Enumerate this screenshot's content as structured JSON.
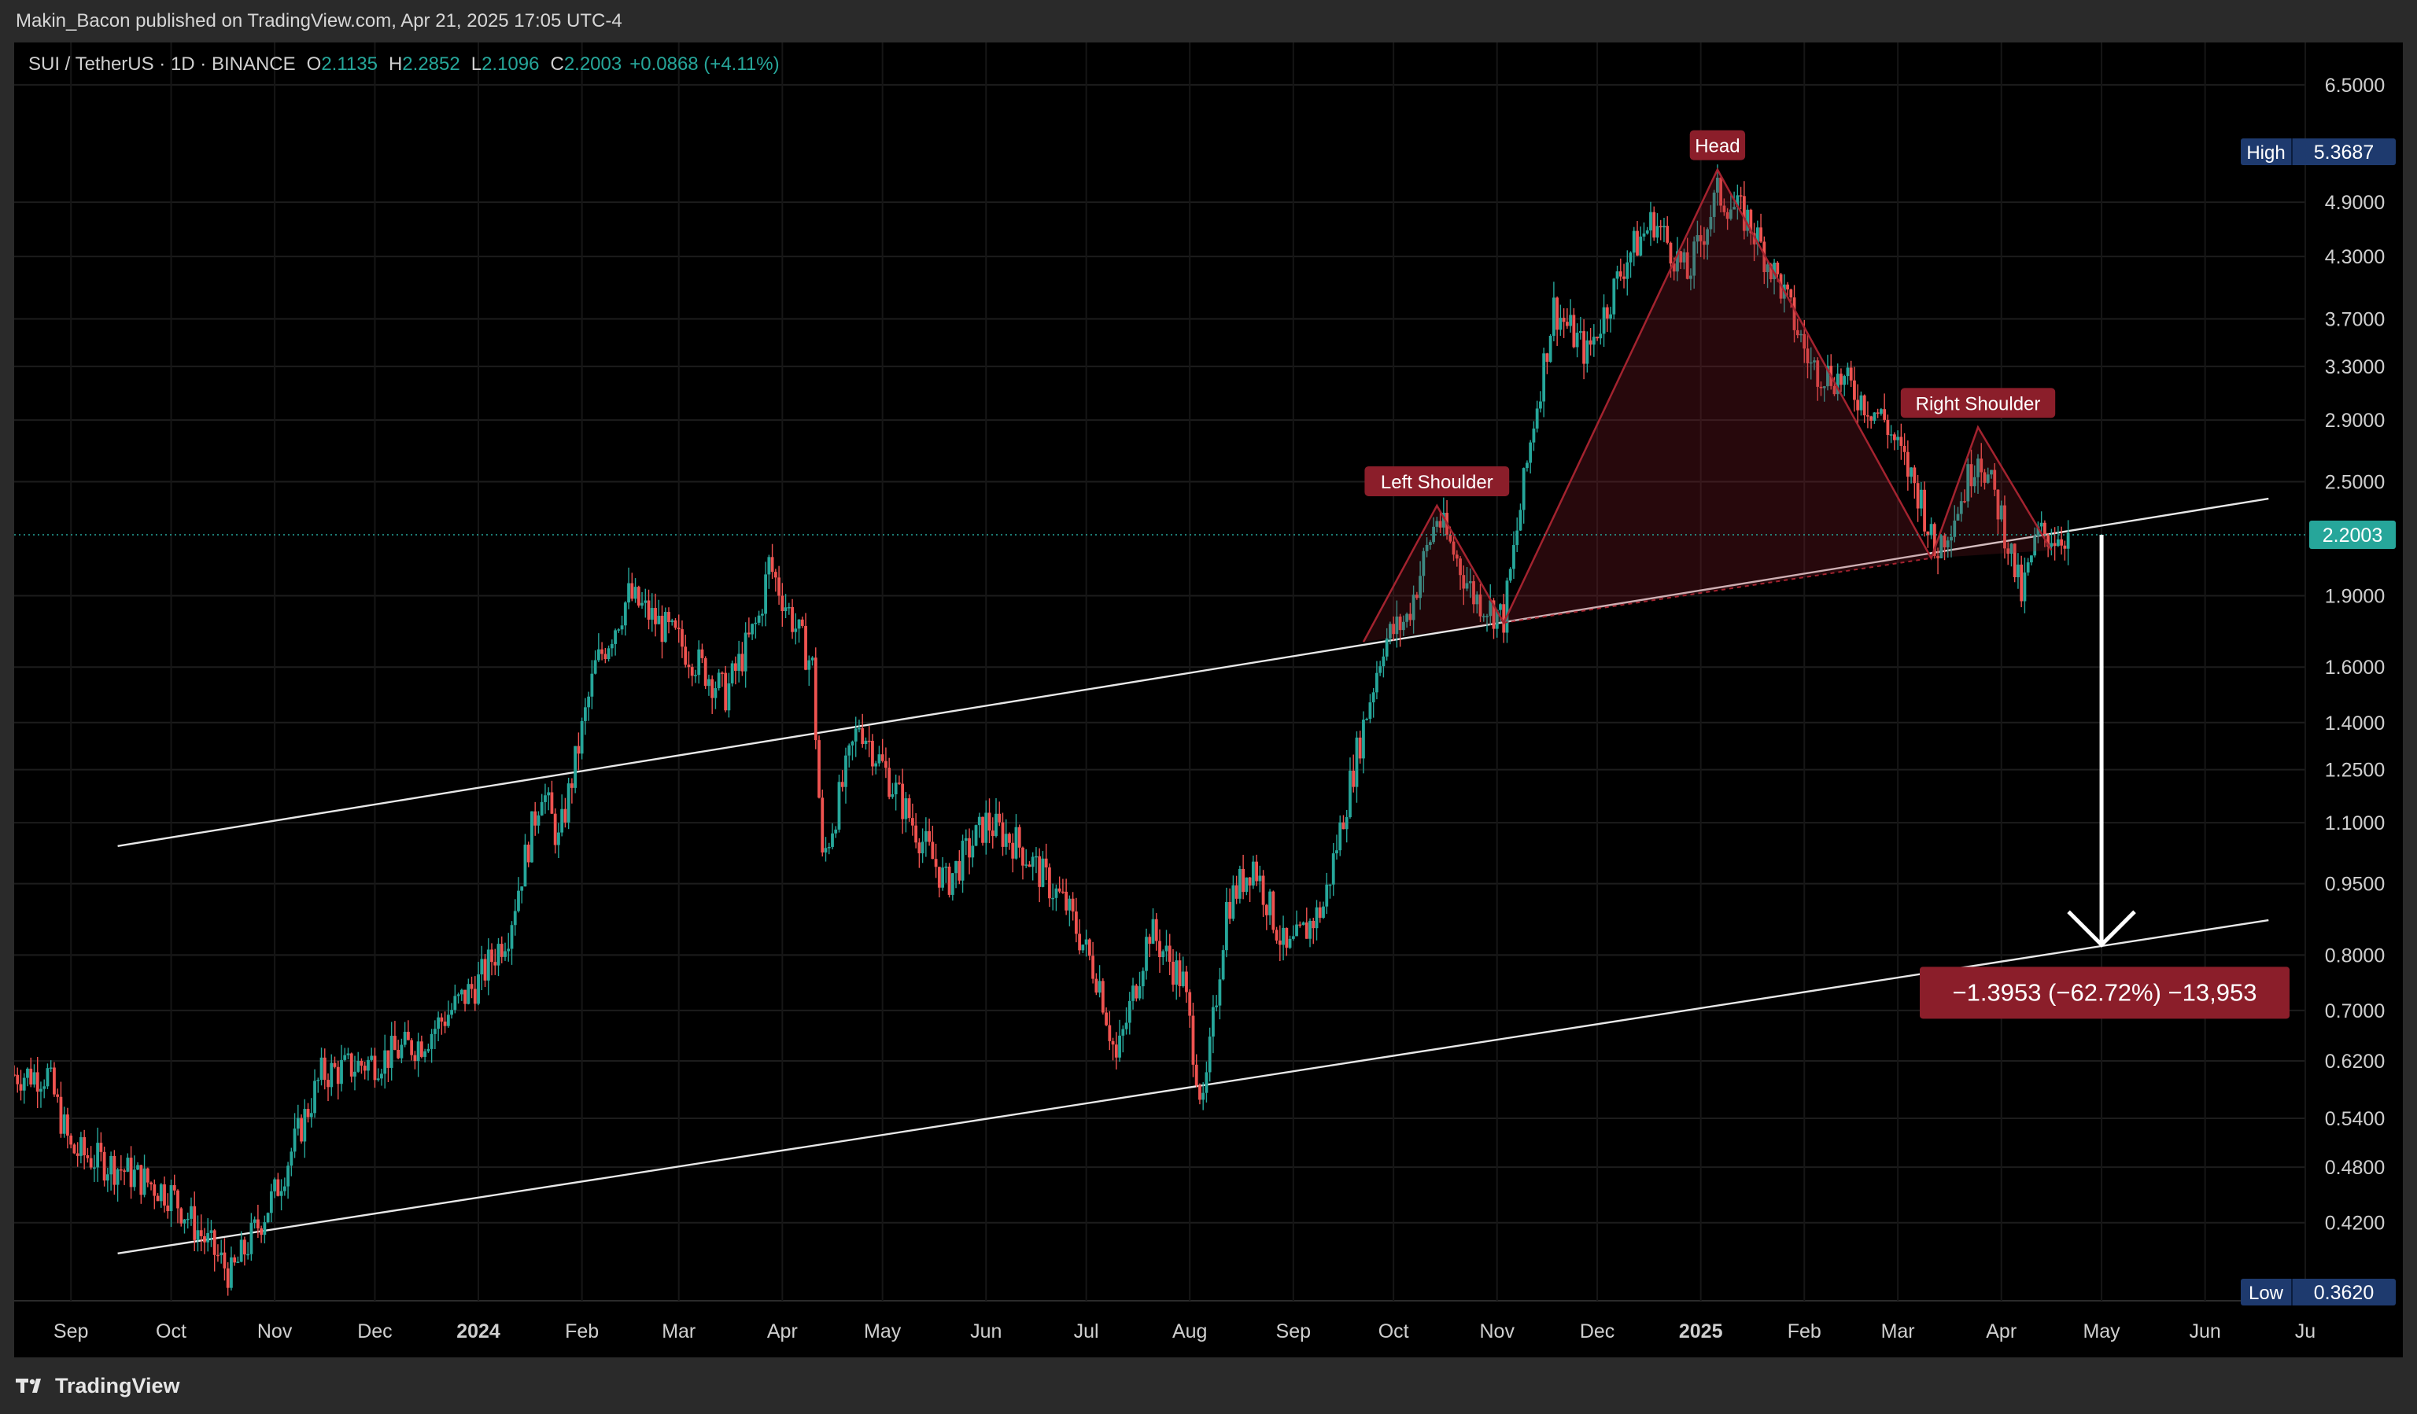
{
  "header": {
    "published_text": "Makin_Bacon published on TradingView.com, Apr 21, 2025 17:05 UTC-4"
  },
  "legend": {
    "symbol": "SUI / TetherUS · 1D · BINANCE",
    "open_label": "O",
    "open_value": "2.1135",
    "high_label": "H",
    "high_value": "2.2852",
    "low_label": "L",
    "low_value": "2.1096",
    "close_label": "C",
    "close_value": "2.2003",
    "change_value": "+0.0868 (+4.11%)"
  },
  "footer": {
    "brand": "TradingView"
  },
  "colors": {
    "up": "#26a69a",
    "down": "#ef5350",
    "pattern": "#8b1e2a",
    "price_label_bg": "#26a69a",
    "hl_label_bg": "#1e3a6e",
    "measure_bg": "#8b1e2a"
  },
  "chart_data": {
    "type": "candlestick",
    "title": "SUI / TetherUS · 1D · BINANCE",
    "scale": "log",
    "ylim": [
      0.35,
      6.8
    ],
    "y_ticks": [
      "6.5000",
      "4.9000",
      "4.3000",
      "3.7000",
      "3.3000",
      "2.9000",
      "2.5000",
      "1.9000",
      "1.6000",
      "1.4000",
      "1.2500",
      "1.1000",
      "0.9500",
      "0.8000",
      "0.7000",
      "0.6200",
      "0.5400",
      "0.4800",
      "0.4200"
    ],
    "x_ticks": [
      "Sep",
      "Oct",
      "Nov",
      "Dec",
      "2024",
      "Feb",
      "Mar",
      "Apr",
      "May",
      "Jun",
      "Jul",
      "Aug",
      "Sep",
      "Oct",
      "Nov",
      "Dec",
      "2025",
      "Feb",
      "Mar",
      "Apr",
      "May",
      "Jun",
      "Ju"
    ],
    "x_range": [
      "2023-08-15",
      "2025-07-01"
    ],
    "last_price": {
      "value": 2.2003,
      "label": "2.2003"
    },
    "high_marker": {
      "label": "High",
      "value": 5.3687,
      "value_label": "5.3687"
    },
    "low_marker": {
      "label": "Low",
      "value": 0.362,
      "value_label": "0.3620"
    },
    "price_path_anchors": [
      [
        "2023-08-15",
        0.6
      ],
      [
        "2023-08-25",
        0.6
      ],
      [
        "2023-09-01",
        0.5
      ],
      [
        "2023-09-15",
        0.48
      ],
      [
        "2023-10-01",
        0.45
      ],
      [
        "2023-10-19",
        0.37
      ],
      [
        "2023-11-01",
        0.45
      ],
      [
        "2023-11-15",
        0.6
      ],
      [
        "2023-12-01",
        0.62
      ],
      [
        "2023-12-15",
        0.65
      ],
      [
        "2024-01-01",
        0.75
      ],
      [
        "2024-01-10",
        0.85
      ],
      [
        "2024-01-20",
        1.2
      ],
      [
        "2024-01-25",
        1.05
      ],
      [
        "2024-02-05",
        1.6
      ],
      [
        "2024-02-15",
        1.9
      ],
      [
        "2024-03-01",
        1.7
      ],
      [
        "2024-03-15",
        1.5
      ],
      [
        "2024-03-25",
        1.8
      ],
      [
        "2024-03-28",
        2.05
      ],
      [
        "2024-04-10",
        1.6
      ],
      [
        "2024-04-13",
        1.0
      ],
      [
        "2024-04-24",
        1.4
      ],
      [
        "2024-05-10",
        1.1
      ],
      [
        "2024-05-20",
        0.95
      ],
      [
        "2024-06-01",
        1.1
      ],
      [
        "2024-06-10",
        1.05
      ],
      [
        "2024-06-25",
        0.9
      ],
      [
        "2024-07-05",
        0.75
      ],
      [
        "2024-07-10",
        0.62
      ],
      [
        "2024-07-20",
        0.85
      ],
      [
        "2024-07-30",
        0.75
      ],
      [
        "2024-08-05",
        0.55
      ],
      [
        "2024-08-12",
        0.9
      ],
      [
        "2024-08-20",
        1.0
      ],
      [
        "2024-08-30",
        0.8
      ],
      [
        "2024-09-10",
        0.9
      ],
      [
        "2024-09-20",
        1.3
      ],
      [
        "2024-09-28",
        1.7
      ],
      [
        "2024-10-05",
        1.8
      ],
      [
        "2024-10-14",
        2.3
      ],
      [
        "2024-10-25",
        1.9
      ],
      [
        "2024-11-03",
        1.8
      ],
      [
        "2024-11-12",
        2.9
      ],
      [
        "2024-11-18",
        3.8
      ],
      [
        "2024-11-28",
        3.4
      ],
      [
        "2024-12-10",
        4.3
      ],
      [
        "2024-12-18",
        4.7
      ],
      [
        "2024-12-28",
        4.1
      ],
      [
        "2025-01-06",
        5.0
      ],
      [
        "2025-01-15",
        4.7
      ],
      [
        "2025-01-25",
        4.0
      ],
      [
        "2025-02-03",
        3.3
      ],
      [
        "2025-02-12",
        3.2
      ],
      [
        "2025-02-25",
        2.9
      ],
      [
        "2025-03-08",
        2.4
      ],
      [
        "2025-03-12",
        2.1
      ],
      [
        "2025-03-20",
        2.4
      ],
      [
        "2025-03-25",
        2.7
      ],
      [
        "2025-04-01",
        2.3
      ],
      [
        "2025-04-07",
        1.9
      ],
      [
        "2025-04-12",
        2.2
      ],
      [
        "2025-04-21",
        2.2
      ]
    ],
    "channel_upper": {
      "start": [
        "2023-09-15",
        1.04
      ],
      "end": [
        "2025-06-20",
        2.4
      ]
    },
    "channel_lower": {
      "start": [
        "2023-09-15",
        0.39
      ],
      "end": [
        "2025-06-20",
        0.87
      ]
    },
    "pattern_points": [
      [
        "2024-09-22",
        1.7
      ],
      [
        "2024-10-14",
        2.36
      ],
      [
        "2024-11-03",
        1.78
      ],
      [
        "2025-01-06",
        5.3
      ],
      [
        "2025-03-11",
        2.08
      ],
      [
        "2025-03-25",
        2.85
      ],
      [
        "2025-04-16",
        2.12
      ]
    ],
    "pattern_labels": [
      {
        "text": "Left Shoulder",
        "date": "2024-10-14",
        "value": 2.36
      },
      {
        "text": "Head",
        "date": "2025-01-06",
        "value": 5.3
      },
      {
        "text": "Right Shoulder",
        "date": "2025-03-25",
        "value": 2.85
      }
    ],
    "measure": {
      "from": [
        "2025-05-01",
        2.2
      ],
      "to": [
        "2025-05-01",
        0.82
      ],
      "label": "−1.3953 (−62.72%) −13,953"
    }
  }
}
